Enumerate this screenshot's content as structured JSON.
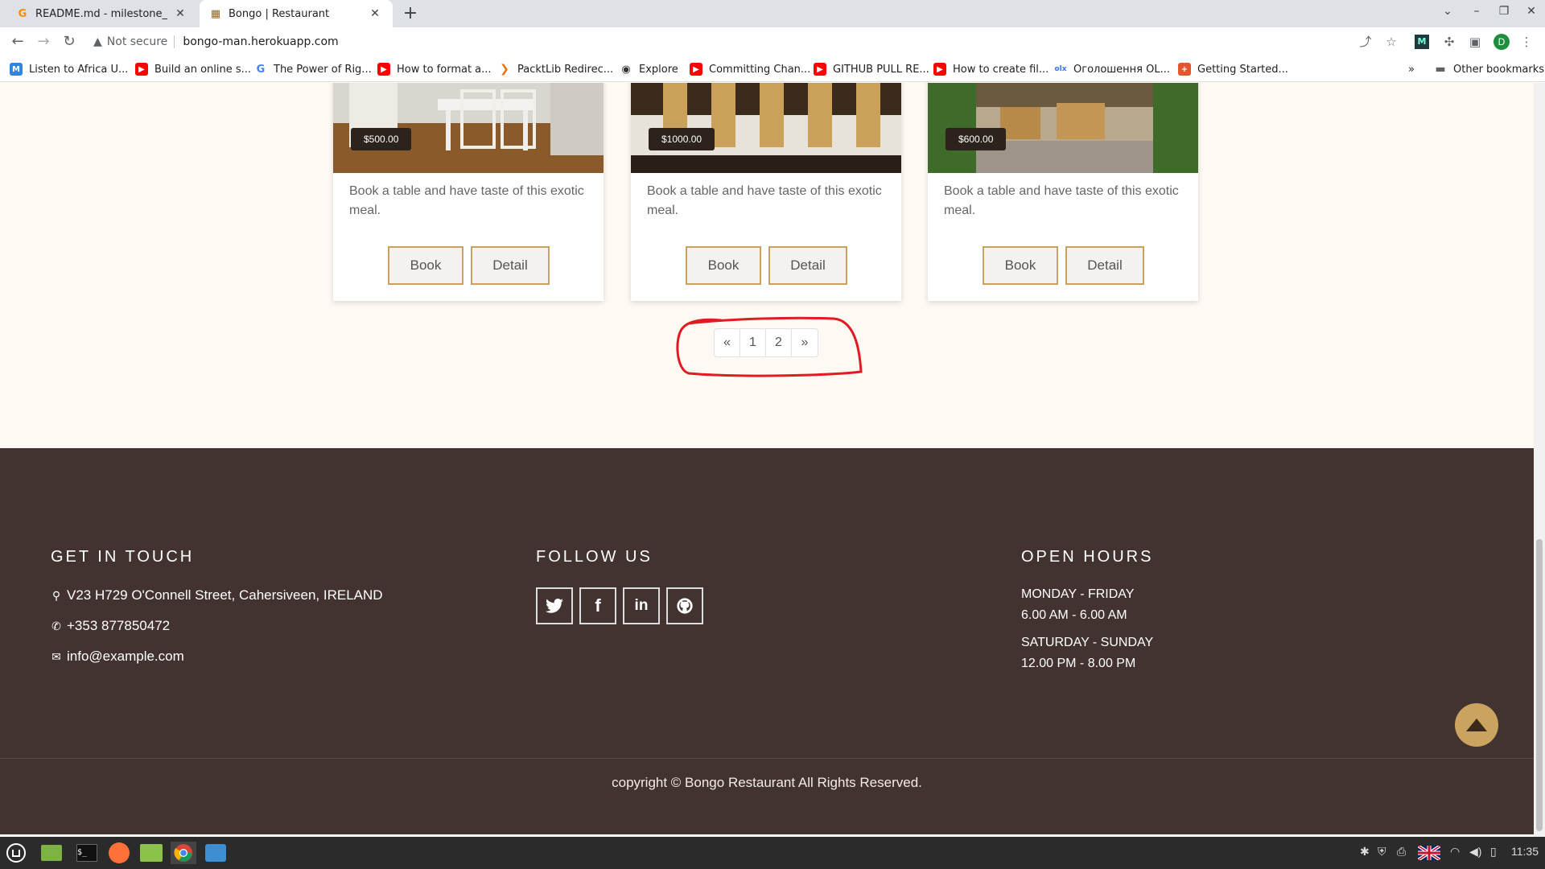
{
  "browser": {
    "tabs": [
      {
        "title": "README.md - milestone_pr",
        "state": "inactive"
      },
      {
        "title": "Bongo | Restaurant",
        "state": "active"
      }
    ],
    "url": "bongo-man.herokuapp.com",
    "security_label": "Not secure",
    "profile_initial": "D",
    "bookmarks": [
      {
        "label": "Listen to Africa U...",
        "icon": "m-icon"
      },
      {
        "label": "Build an online s...",
        "icon": "youtube-icon"
      },
      {
        "label": "The Power of Rig...",
        "icon": "google-icon"
      },
      {
        "label": "How to format a...",
        "icon": "youtube-icon"
      },
      {
        "label": "PacktLib Redirec...",
        "icon": "packt-icon"
      },
      {
        "label": "Explore",
        "icon": "globe-icon"
      },
      {
        "label": "Committing Chan...",
        "icon": "youtube-icon"
      },
      {
        "label": "GITHUB PULL RE...",
        "icon": "youtube-icon"
      },
      {
        "label": "How to create fil...",
        "icon": "youtube-icon"
      },
      {
        "label": "Оголошення OL...",
        "icon": "olx-icon"
      },
      {
        "label": "Getting Started...",
        "icon": "plus-icon"
      }
    ],
    "other_bookmarks": "Other bookmarks"
  },
  "cards": [
    {
      "price": "$500.00",
      "description": "Book a table and have taste of this exotic meal.",
      "book_label": "Book",
      "detail_label": "Detail"
    },
    {
      "price": "$1000.00",
      "description": "Book a table and have taste of this exotic meal.",
      "book_label": "Book",
      "detail_label": "Detail"
    },
    {
      "price": "$600.00",
      "description": "Book a table and have taste of this exotic meal.",
      "book_label": "Book",
      "detail_label": "Detail"
    }
  ],
  "pagination": {
    "prev": "«",
    "pages": [
      "1",
      "2"
    ],
    "next": "»"
  },
  "footer": {
    "contact": {
      "heading": "GET IN TOUCH",
      "address": "V23 H729 O'Connell Street, Cahersiveen, IRELAND",
      "phone": "+353 877850472",
      "email": "info@example.com"
    },
    "follow": {
      "heading": "FOLLOW US",
      "links": [
        "twitter-icon",
        "facebook-icon",
        "linkedin-icon",
        "github-icon"
      ]
    },
    "hours": {
      "heading": "OPEN HOURS",
      "rows": [
        {
          "days": "MONDAY - FRIDAY",
          "time": "6.00 AM - 6.00 AM"
        },
        {
          "days": "SATURDAY - SUNDAY",
          "time": "12.00 PM - 8.00 PM"
        }
      ]
    },
    "copyright": "copyright © Bongo Restaurant All Rights Reserved."
  },
  "taskbar": {
    "clock": "11:35"
  },
  "colors": {
    "page_bg": "#fef9f2",
    "footer_bg": "#433330",
    "accent_gold": "#c9a35f",
    "annotation_red": "#e01b24"
  }
}
